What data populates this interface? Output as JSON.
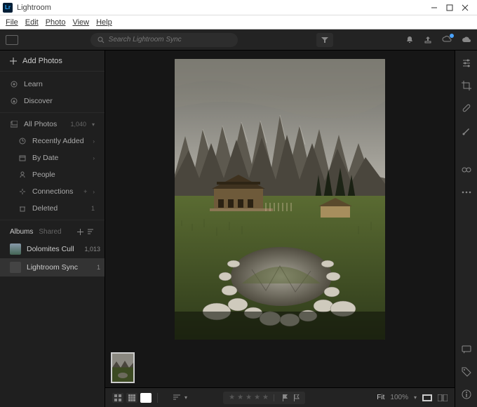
{
  "window": {
    "title": "Lightroom"
  },
  "menu": {
    "file": "File",
    "edit": "Edit",
    "photo": "Photo",
    "view": "View",
    "help": "Help"
  },
  "search": {
    "placeholder": "Search Lightroom Sync"
  },
  "sidebar": {
    "addPhotos": "Add Photos",
    "learn": "Learn",
    "discover": "Discover",
    "allPhotos": {
      "label": "All Photos",
      "count": "1,040"
    },
    "recentlyAdded": "Recently Added",
    "byDate": "By Date",
    "people": "People",
    "connections": "Connections",
    "deleted": {
      "label": "Deleted",
      "count": "1"
    },
    "albumsHeader": "Albums",
    "sharedHeader": "Shared",
    "albums": [
      {
        "label": "Dolomites Cull",
        "count": "1,013"
      },
      {
        "label": "Lightroom Sync",
        "count": "1"
      }
    ]
  },
  "bottombar": {
    "fit": "Fit",
    "zoom": "100%"
  }
}
